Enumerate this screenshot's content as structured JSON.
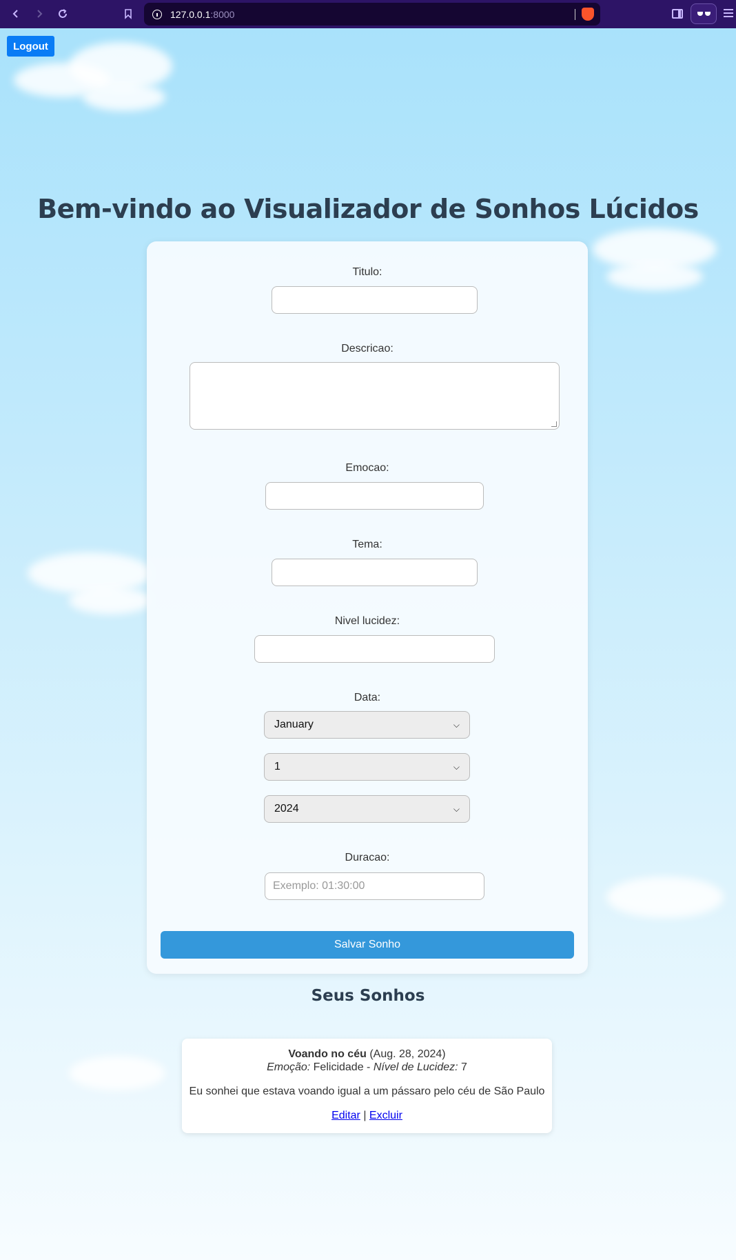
{
  "browser": {
    "url_host": "127.0.0.1",
    "url_port": ":8000"
  },
  "page": {
    "logout_label": "Logout",
    "title": "Bem-vindo ao Visualizador de Sonhos Lúcidos"
  },
  "form": {
    "titulo_label": "Titulo:",
    "titulo_value": "",
    "descricao_label": "Descricao:",
    "descricao_value": "",
    "emocao_label": "Emocao:",
    "emocao_value": "",
    "tema_label": "Tema:",
    "tema_value": "",
    "nivel_label": "Nivel lucidez:",
    "nivel_value": "",
    "data_label": "Data:",
    "month_selected": "January",
    "day_selected": "1",
    "year_selected": "2024",
    "duracao_label": "Duracao:",
    "duracao_placeholder": "Exemplo: 01:30:00",
    "save_label": "Salvar Sonho"
  },
  "dreams": {
    "section_title": "Seus Sonhos",
    "items": [
      {
        "title": "Voando no céu",
        "date": "(Aug. 28, 2024)",
        "emotion_label": "Emoção:",
        "emotion": "Felicidade",
        "separator": "-",
        "lucidity_label": "Nível de Lucidez:",
        "lucidity": "7",
        "description": "Eu sonhei que estava voando igual a um pássaro pelo céu de São Paulo",
        "edit_label": "Editar",
        "link_separator": "|",
        "delete_label": "Excluir"
      }
    ]
  },
  "colors": {
    "accent_blue": "#3498db",
    "logout_blue": "#0a7cf5",
    "title_color": "#2c3e50",
    "browser_chrome": "#2d1466"
  }
}
